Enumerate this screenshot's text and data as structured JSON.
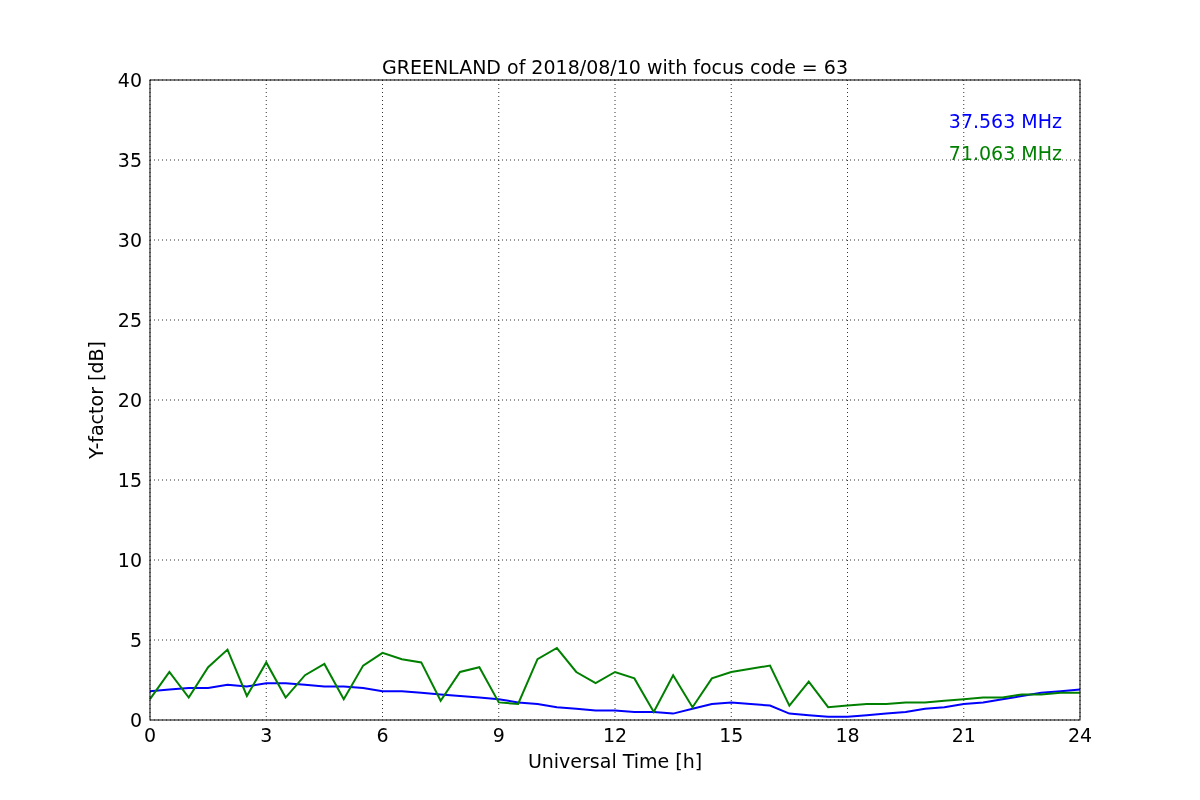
{
  "chart_data": {
    "type": "line",
    "title": "GREENLAND of 2018/08/10 with focus code = 63",
    "xlabel": "Universal Time [h]",
    "ylabel": "Y-factor [dB]",
    "x": [
      0,
      0.5,
      1,
      1.5,
      2,
      2.5,
      3,
      3.5,
      4,
      4.5,
      5,
      5.5,
      6,
      6.5,
      7,
      7.5,
      8,
      8.5,
      9,
      9.5,
      10,
      10.5,
      11,
      11.5,
      12,
      12.5,
      13,
      13.5,
      14,
      14.5,
      15,
      15.5,
      16,
      16.5,
      17,
      17.5,
      18,
      18.5,
      19,
      19.5,
      20,
      20.5,
      21,
      21.5,
      22,
      22.5,
      23,
      23.5,
      24
    ],
    "series": [
      {
        "name": "37.563 MHz",
        "color": "#0000ff",
        "values": [
          1.8,
          1.9,
          2.0,
          2.0,
          2.2,
          2.1,
          2.3,
          2.3,
          2.2,
          2.1,
          2.1,
          2.0,
          1.8,
          1.8,
          1.7,
          1.6,
          1.5,
          1.4,
          1.3,
          1.1,
          1.0,
          0.8,
          0.7,
          0.6,
          0.6,
          0.5,
          0.5,
          0.4,
          0.7,
          1.0,
          1.1,
          1.0,
          0.9,
          0.4,
          0.3,
          0.2,
          0.2,
          0.3,
          0.4,
          0.5,
          0.7,
          0.8,
          1.0,
          1.1,
          1.3,
          1.5,
          1.7,
          1.8,
          1.9
        ]
      },
      {
        "name": "71.063 MHz",
        "color": "#008000",
        "values": [
          1.3,
          3.0,
          1.4,
          3.3,
          4.4,
          1.5,
          3.6,
          1.4,
          2.8,
          3.5,
          1.3,
          3.4,
          4.2,
          3.8,
          3.6,
          1.2,
          3.0,
          3.3,
          1.1,
          1.0,
          3.8,
          4.5,
          3.0,
          2.3,
          3.0,
          2.6,
          0.5,
          2.8,
          0.8,
          2.6,
          3.0,
          3.2,
          3.4,
          0.9,
          2.4,
          0.8,
          0.9,
          1.0,
          1.0,
          1.1,
          1.1,
          1.2,
          1.3,
          1.4,
          1.4,
          1.6,
          1.6,
          1.7,
          1.7
        ]
      }
    ],
    "xlim": [
      0,
      24
    ],
    "ylim": [
      0,
      40
    ],
    "xticks": [
      0,
      3,
      6,
      9,
      12,
      15,
      18,
      21,
      24
    ],
    "yticks": [
      0,
      5,
      10,
      15,
      20,
      25,
      30,
      35,
      40
    ],
    "grid": true
  }
}
